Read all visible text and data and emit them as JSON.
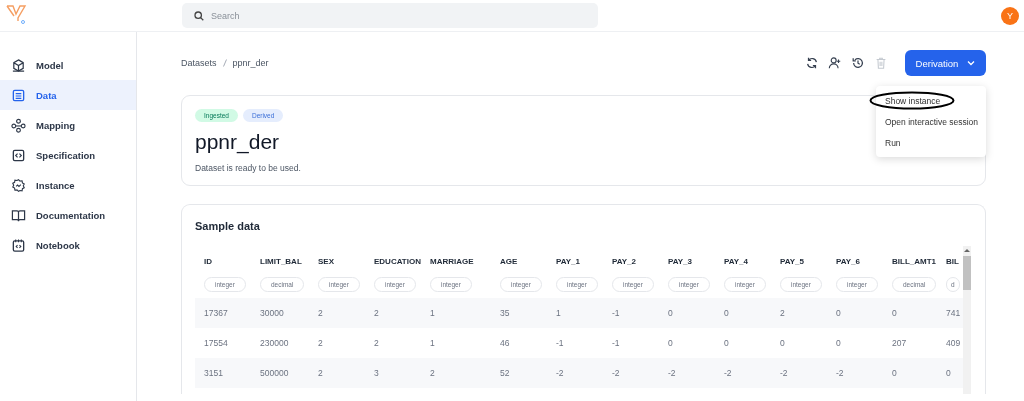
{
  "topbar": {
    "search": {
      "placeholder": "Search"
    },
    "avatar": "Y"
  },
  "sidebar": {
    "items": [
      {
        "label": "Model",
        "kind": "cube",
        "selected": false
      },
      {
        "label": "Data",
        "kind": "sheet",
        "selected": true
      },
      {
        "label": "Mapping",
        "kind": "nodes",
        "selected": false
      },
      {
        "label": "Specification",
        "kind": "code",
        "selected": false
      },
      {
        "label": "Instance",
        "kind": "gear",
        "selected": false
      },
      {
        "label": "Documentation",
        "kind": "book",
        "selected": false
      },
      {
        "label": "Notebook",
        "kind": "notebook",
        "selected": false
      }
    ]
  },
  "breadcrumb": [
    "Datasets",
    "ppnr_der"
  ],
  "toolbar": {
    "actions": [
      {
        "kind": "refresh",
        "disabled": false
      },
      {
        "kind": "add-user",
        "disabled": false
      },
      {
        "kind": "history",
        "disabled": false
      },
      {
        "kind": "delete",
        "disabled": true
      }
    ],
    "button": "Derivation",
    "menu": {
      "expanded": true,
      "items": [
        {
          "label": "Show instance",
          "circled": true
        },
        {
          "label": "Open interactive session",
          "circled": false
        },
        {
          "label": "Run",
          "circled": false
        }
      ]
    }
  },
  "dataset": {
    "tags": [
      {
        "label": "Ingested",
        "kind": "ingested"
      },
      {
        "label": "Derived",
        "kind": "derived"
      }
    ],
    "title": "ppnr_der",
    "status": "Dataset is ready to be used."
  },
  "sample": {
    "title": "Sample data",
    "columns": [
      {
        "name": "ID",
        "type": "integer"
      },
      {
        "name": "LIMIT_BAL",
        "type": "decimal"
      },
      {
        "name": "SEX",
        "type": "integer"
      },
      {
        "name": "EDUCATION",
        "type": "integer"
      },
      {
        "name": "MARRIAGE",
        "type": "integer"
      },
      {
        "name": "AGE",
        "type": "integer"
      },
      {
        "name": "PAY_1",
        "type": "integer"
      },
      {
        "name": "PAY_2",
        "type": "integer"
      },
      {
        "name": "PAY_3",
        "type": "integer"
      },
      {
        "name": "PAY_4",
        "type": "integer"
      },
      {
        "name": "PAY_5",
        "type": "integer"
      },
      {
        "name": "PAY_6",
        "type": "integer"
      },
      {
        "name": "BILL_AMT1",
        "type": "decimal"
      },
      {
        "name": "BIL",
        "type": "d"
      }
    ],
    "rows": [
      [
        "17367",
        "30000",
        "2",
        "2",
        "1",
        "35",
        "1",
        "-1",
        "0",
        "0",
        "2",
        "0",
        "0",
        "741"
      ],
      [
        "17554",
        "230000",
        "2",
        "2",
        "1",
        "46",
        "-1",
        "-1",
        "0",
        "0",
        "0",
        "0",
        "207",
        "409"
      ],
      [
        "3151",
        "500000",
        "2",
        "3",
        "2",
        "52",
        "-2",
        "-2",
        "-2",
        "-2",
        "-2",
        "-2",
        "0",
        "0"
      ]
    ]
  }
}
